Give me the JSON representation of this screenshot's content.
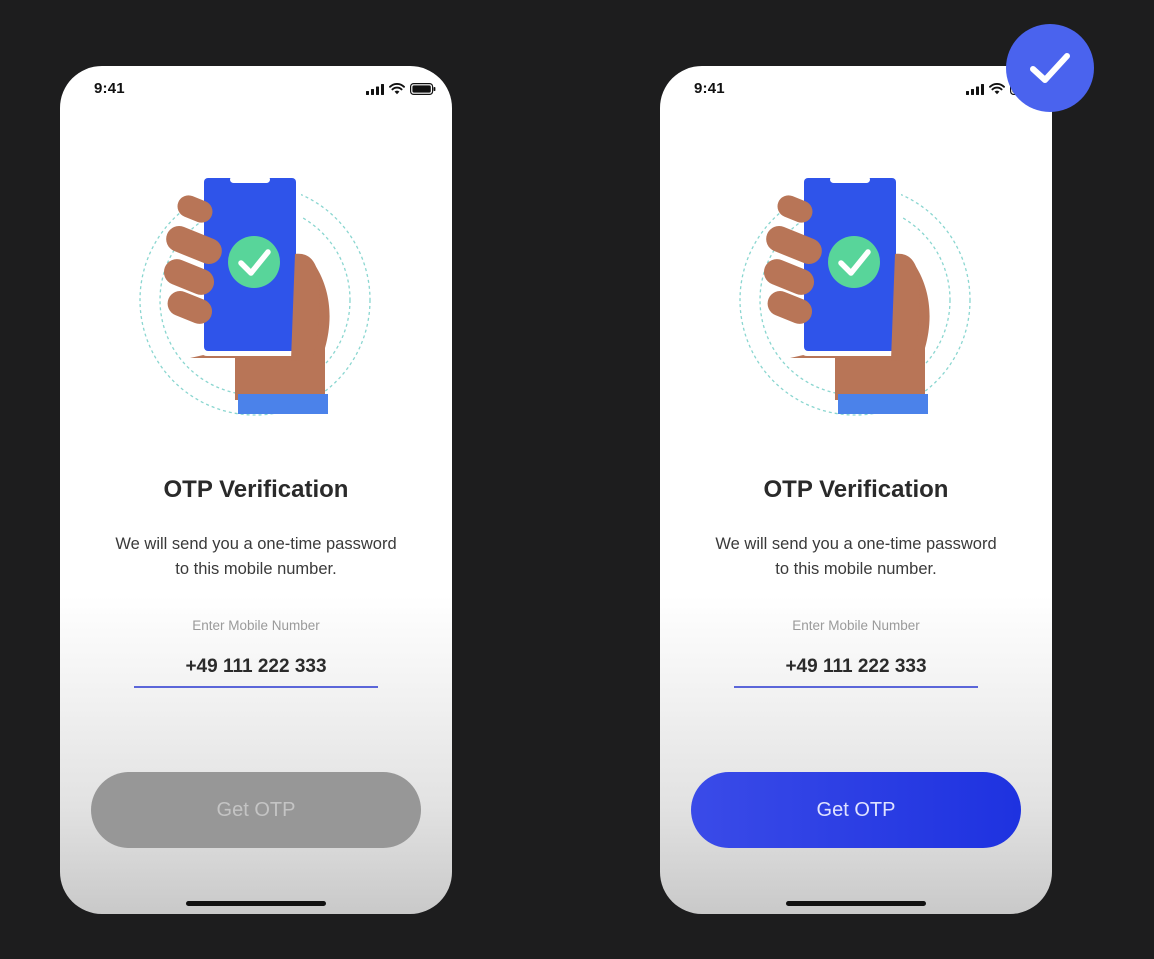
{
  "colors": {
    "background": "#1d1d1e",
    "phone_blue": "#2f54ea",
    "check_green": "#58d59a",
    "skin": "#b87557",
    "sleeve": "#4b82ea",
    "button_disabled": "#979797",
    "button_enabled": "#2c3fe6",
    "input_underline": "#5b66d9",
    "badge": "#4a63ee"
  },
  "screens": [
    {
      "variant": "disabled",
      "status_time": "9:41",
      "status_icons": [
        "signal-icon",
        "wifi-icon",
        "battery-icon"
      ],
      "illustration": "hand-holding-phone-check-illustration",
      "title": "OTP Verification",
      "description_line1": "We will send you a one-time password",
      "description_line2": "to this mobile number.",
      "input_label": "Enter Mobile Number",
      "input_value": "+49 111 222 333",
      "button_label": "Get OTP"
    },
    {
      "variant": "enabled",
      "status_time": "9:41",
      "status_icons": [
        "signal-icon",
        "wifi-icon",
        "battery-icon"
      ],
      "illustration": "hand-holding-phone-check-illustration",
      "title": "OTP Verification",
      "description_line1": "We will send you a one-time password",
      "description_line2": "to this mobile number.",
      "input_label": "Enter Mobile Number",
      "input_value": "+49 111 222 333",
      "button_label": "Get OTP"
    }
  ],
  "selected_badge": {
    "icon": "checkmark-icon"
  }
}
